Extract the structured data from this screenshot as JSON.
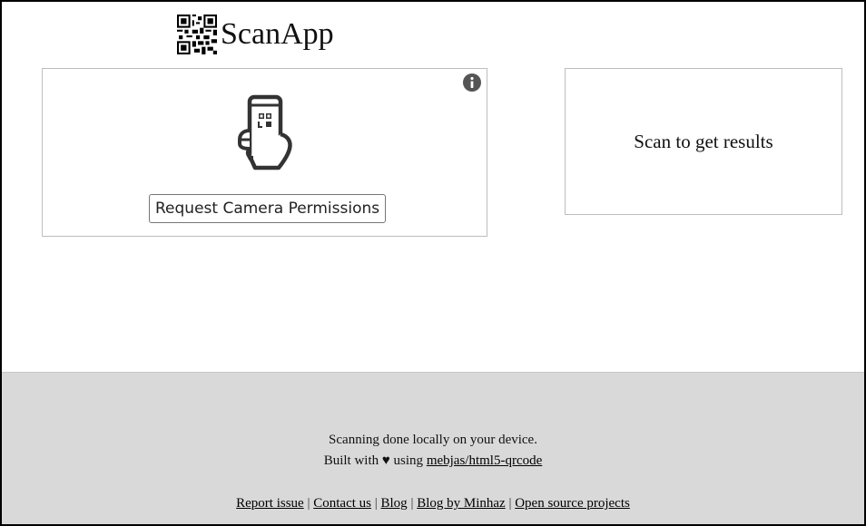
{
  "header": {
    "logo_icon": "qr-code-icon",
    "title": "ScanApp"
  },
  "scanner": {
    "info_icon": "info-circle-icon",
    "illustration_icon": "phone-scan-icon",
    "camera_button_label": "Request Camera Permissions"
  },
  "result": {
    "placeholder": "Scan to get results"
  },
  "footer": {
    "line1": "Scanning done locally on your device.",
    "line2_prefix": "Built with ♥ using",
    "library_link": "mebjas/html5-qrcode",
    "links": [
      {
        "label": "Report issue"
      },
      {
        "label": "Contact us"
      },
      {
        "label": "Blog"
      },
      {
        "label": "Blog by Minhaz"
      },
      {
        "label": "Open source projects"
      }
    ],
    "separator": "|"
  },
  "colors": {
    "footer_bg": "#d9d9d9",
    "box_border": "#bdbdbd",
    "icon_dark": "#333333"
  }
}
